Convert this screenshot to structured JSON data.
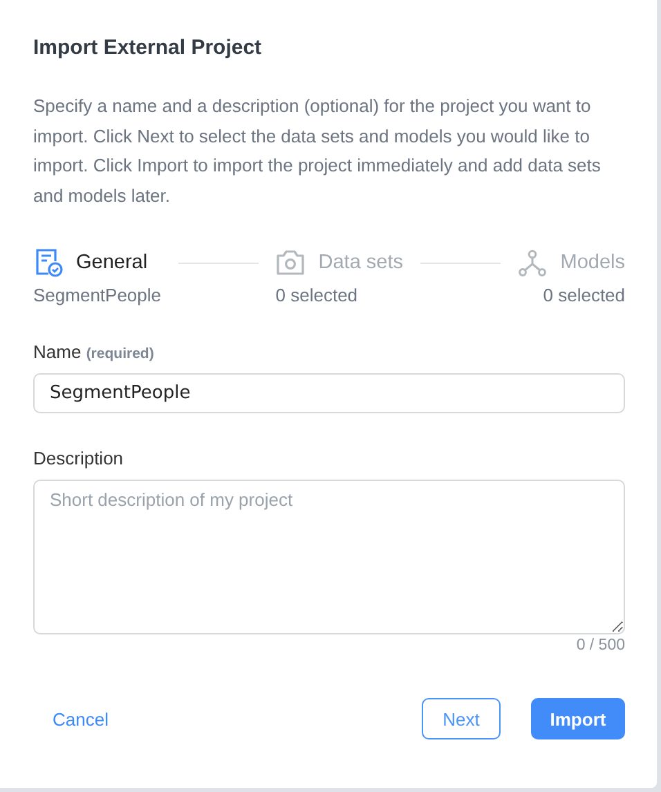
{
  "dialog": {
    "title": "Import External Project",
    "intro": "Specify a name and a description (optional) for the project you want to import. Click Next to select the data sets and models you would like to import. Click Import to import the project immediately and add data sets and models later."
  },
  "steps": [
    {
      "kind": "general",
      "label": "General",
      "detail": "SegmentPeople",
      "selected": true
    },
    {
      "kind": "datasets",
      "label": "Data sets",
      "detail": "0 selected",
      "selected": false
    },
    {
      "kind": "models",
      "label": "Models",
      "detail": "0 selected",
      "selected": false
    }
  ],
  "name_field": {
    "label": "Name",
    "hint": "(required)",
    "value": "SegmentPeople"
  },
  "description_field": {
    "label": "Description",
    "placeholder": "Short description of my project",
    "counter": "0 / 500"
  },
  "buttons": {
    "cancel": "Cancel",
    "next": "Next",
    "import": "Import"
  }
}
